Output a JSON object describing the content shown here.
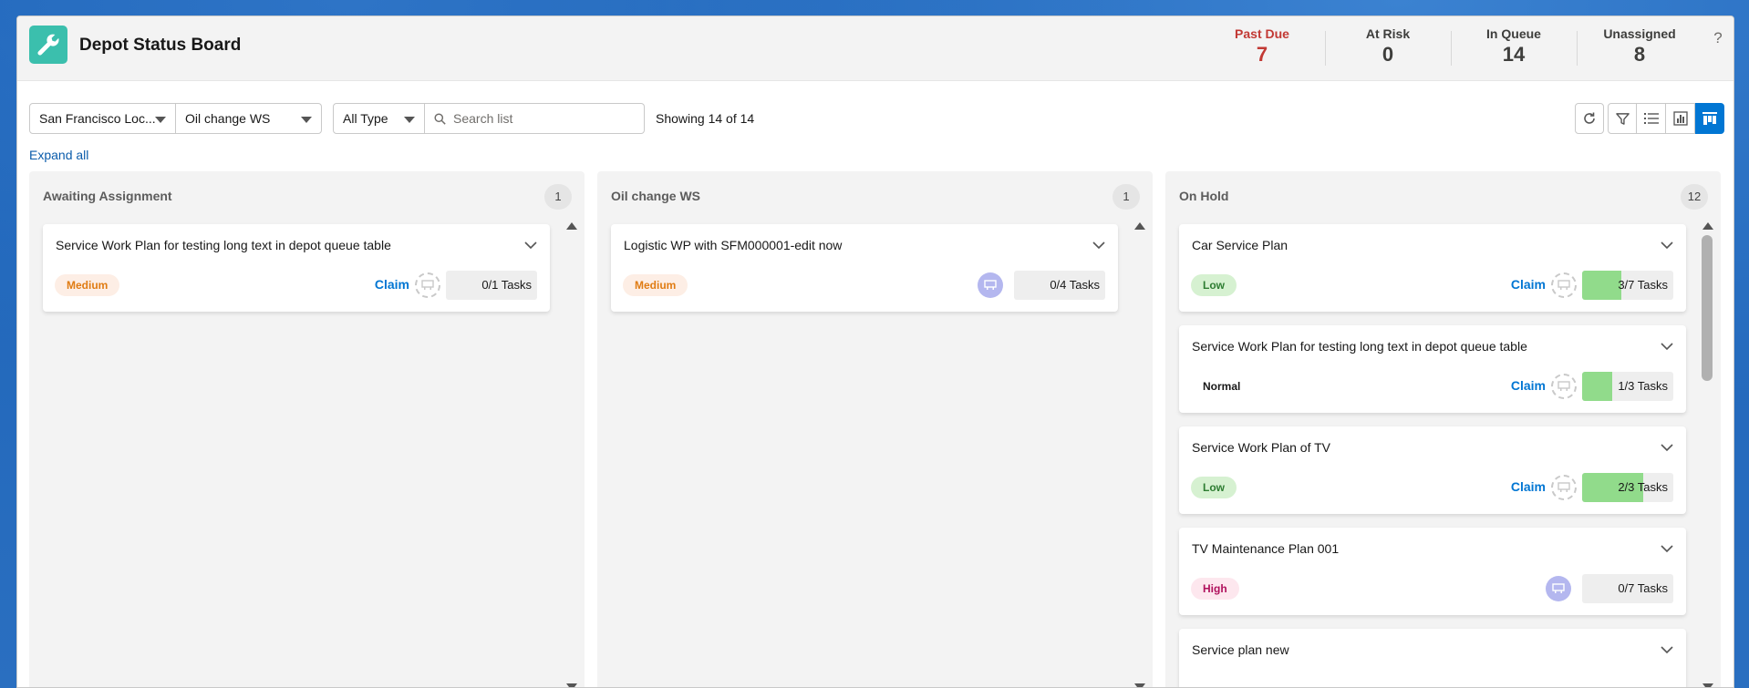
{
  "header": {
    "title": "Depot Status Board",
    "app_icon": "wrench-icon",
    "kpis": [
      {
        "label": "Past Due",
        "value": "7",
        "color": "#c23934"
      },
      {
        "label": "At Risk",
        "value": "0"
      },
      {
        "label": "In Queue",
        "value": "14"
      },
      {
        "label": "Unassigned",
        "value": "8"
      }
    ],
    "help": "?"
  },
  "filters": {
    "location": "San Francisco Loc...",
    "workstation": "Oil change WS",
    "type": "All Type",
    "search_placeholder": "Search list",
    "showing": "Showing 14 of 14"
  },
  "toolbar": {
    "refresh": "refresh-icon",
    "filter": "filter-icon",
    "list_view": "list-icon",
    "chart_view": "bar-chart-icon",
    "board_view": "kanban-icon",
    "active": "board_view",
    "accent": "#0176d3"
  },
  "expand_all": "Expand all",
  "columns": [
    {
      "title": "Awaiting Assignment",
      "count": "1",
      "cards": [
        {
          "title": "Service Work Plan for testing long text in depot queue table",
          "priority": "Medium",
          "claim": "Claim",
          "tasks": "0/1 Tasks",
          "progress": 0
        }
      ]
    },
    {
      "title": "Oil change WS",
      "count": "1",
      "cards": [
        {
          "title": "Logistic WP with SFM000001-edit now",
          "priority": "Medium",
          "tasks": "0/4 Tasks",
          "progress": 0
        }
      ]
    },
    {
      "title": "On Hold",
      "count": "12",
      "cards": [
        {
          "title": "Car Service Plan",
          "priority": "Low",
          "claim": "Claim",
          "tasks": "3/7 Tasks",
          "progress": 0.43
        },
        {
          "title": "Service Work Plan for testing long text in depot queue table",
          "priority": "Normal",
          "claim": "Claim",
          "tasks": "1/3 Tasks",
          "progress": 0.33
        },
        {
          "title": "Service Work Plan of TV",
          "priority": "Low",
          "claim": "Claim",
          "tasks": "2/3 Tasks",
          "progress": 0.67
        },
        {
          "title": "TV Maintenance Plan 001",
          "priority": "High",
          "tasks": "0/7 Tasks",
          "progress": 0
        },
        {
          "title": "Service plan new"
        }
      ]
    }
  ]
}
